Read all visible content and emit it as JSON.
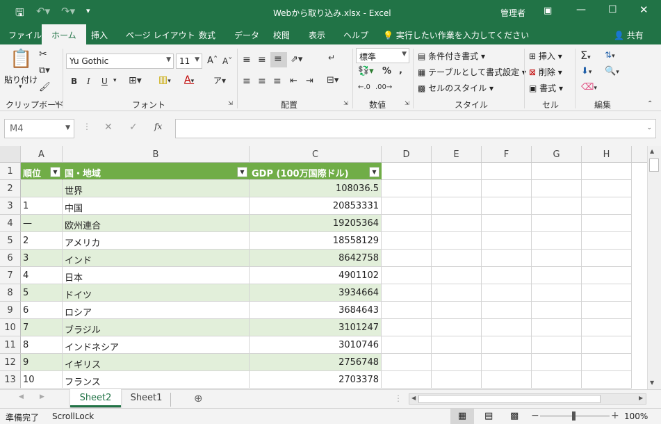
{
  "title_bar": {
    "save_icon": "save-icon",
    "filename": "Webから取り込み.xlsx",
    "separator": "-",
    "app": "Excel",
    "user": "管理者"
  },
  "ribbon_tabs": [
    "ファイル",
    "ホーム",
    "挿入",
    "ページ レイアウト",
    "数式",
    "データ",
    "校閲",
    "表示",
    "ヘルプ"
  ],
  "active_tab": "ホーム",
  "tell_me": "実行したい作業を入力してください",
  "share": "共有",
  "ribbon": {
    "clipboard": {
      "paste": "貼り付け",
      "group": "クリップボード"
    },
    "font": {
      "name": "Yu Gothic",
      "size": "11",
      "group": "フォント",
      "bold": "B",
      "italic": "I",
      "underline": "U"
    },
    "alignment": {
      "group": "配置"
    },
    "number": {
      "format": "標準",
      "percent": "%",
      "comma": ",",
      "group": "数値"
    },
    "styles": {
      "conditional": "条件付き書式",
      "table": "テーブルとして書式設定",
      "cell": "セルのスタイル",
      "group": "スタイル"
    },
    "cells": {
      "insert": "挿入",
      "delete": "削除",
      "format": "書式",
      "group": "セル"
    },
    "editing": {
      "group": "編集"
    }
  },
  "formula_bar": {
    "name_box": "M4",
    "fx": "fx",
    "value": ""
  },
  "columns": [
    "A",
    "B",
    "C",
    "D",
    "E",
    "F",
    "G",
    "H"
  ],
  "header_row": {
    "a": "順位",
    "b": "国・地域",
    "c": "GDP (100万国際ドル)"
  },
  "rows": [
    {
      "num": "2",
      "a": "",
      "b": "世界",
      "c": "108036.5"
    },
    {
      "num": "3",
      "a": "1",
      "b": "中国",
      "c": "20853331"
    },
    {
      "num": "4",
      "a": "—",
      "b": "欧州連合",
      "c": "19205364"
    },
    {
      "num": "5",
      "a": "2",
      "b": "アメリカ",
      "c": "18558129"
    },
    {
      "num": "6",
      "a": "3",
      "b": "インド",
      "c": "8642758"
    },
    {
      "num": "7",
      "a": "4",
      "b": "日本",
      "c": "4901102"
    },
    {
      "num": "8",
      "a": "5",
      "b": "ドイツ",
      "c": "3934664"
    },
    {
      "num": "9",
      "a": "6",
      "b": "ロシア",
      "c": "3684643"
    },
    {
      "num": "10",
      "a": "7",
      "b": "ブラジル",
      "c": "3101247"
    },
    {
      "num": "11",
      "a": "8",
      "b": "インドネシア",
      "c": "3010746"
    },
    {
      "num": "12",
      "a": "9",
      "b": "イギリス",
      "c": "2756748"
    },
    {
      "num": "13",
      "a": "10",
      "b": "フランス",
      "c": "2703378"
    }
  ],
  "sheets": [
    "Sheet2",
    "Sheet1"
  ],
  "active_sheet": "Sheet2",
  "status": {
    "ready": "準備完了",
    "scroll_lock": "ScrollLock",
    "zoom": "100%"
  },
  "colors": {
    "excel_green": "#217346",
    "table_header": "#70ad47",
    "band": "#e2efda"
  }
}
